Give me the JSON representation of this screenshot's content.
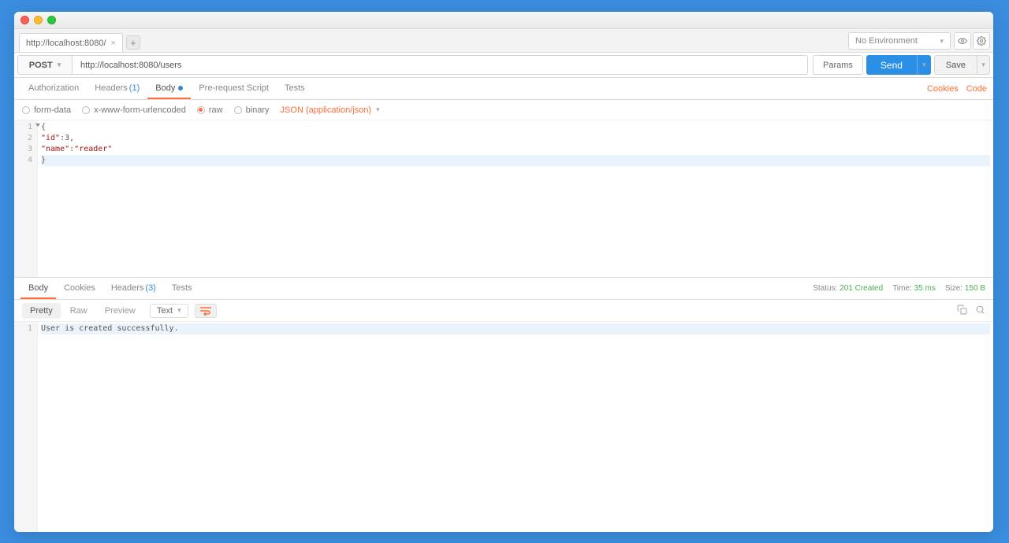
{
  "tab": {
    "title": "http://localhost:8080/"
  },
  "env": {
    "label": "No Environment"
  },
  "urlbar": {
    "method": "POST",
    "url": "http://localhost:8080/users",
    "params": "Params",
    "send": "Send",
    "save": "Save"
  },
  "reqtabs": {
    "auth": "Authorization",
    "headers": "Headers",
    "headers_count": "(1)",
    "body": "Body",
    "prereq": "Pre-request Script",
    "tests": "Tests",
    "cookies": "Cookies",
    "code": "Code"
  },
  "bodytype": {
    "formdata": "form-data",
    "urlencoded": "x-www-form-urlencoded",
    "raw": "raw",
    "binary": "binary",
    "ctype": "JSON (application/json)"
  },
  "request_body": {
    "lines": [
      "{",
      "    \"id\":3,",
      "    \"name\":\"reader\"",
      "}"
    ],
    "json": {
      "id": 3,
      "name": "reader"
    }
  },
  "restabs": {
    "body": "Body",
    "cookies": "Cookies",
    "headers": "Headers",
    "headers_count": "(3)",
    "tests": "Tests"
  },
  "resmeta": {
    "status_label": "Status:",
    "status_value": "201 Created",
    "time_label": "Time:",
    "time_value": "35 ms",
    "size_label": "Size:",
    "size_value": "150 B"
  },
  "resfmt": {
    "pretty": "Pretty",
    "raw": "Raw",
    "preview": "Preview",
    "type": "Text"
  },
  "response_body": {
    "lines": [
      "User is created successfully."
    ]
  }
}
